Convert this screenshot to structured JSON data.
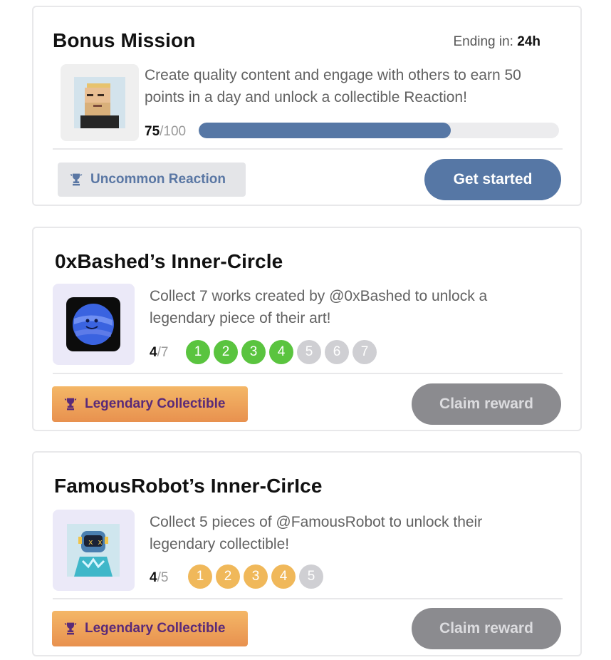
{
  "bonus": {
    "title": "Bonus Mission",
    "ending_label": "Ending in:",
    "ending_value": "24h",
    "description": "Create quality content and engage with others to earn 50 points in a day and unlock a collectible Reaction!",
    "progress_current": "75",
    "progress_total": "/100",
    "progress_fraction": 0.7,
    "reward_label": "Uncommon Reaction",
    "cta_label": "Get started"
  },
  "circle1": {
    "title": "0xBashed’s Inner-Circle",
    "description": "Collect 7 works created by @0xBashed to unlock a legendary piece of their art!",
    "progress_current": "4",
    "progress_total": "/7",
    "steps": [
      {
        "label": "1",
        "done": true
      },
      {
        "label": "2",
        "done": true
      },
      {
        "label": "3",
        "done": true
      },
      {
        "label": "4",
        "done": true
      },
      {
        "label": "5",
        "done": false
      },
      {
        "label": "6",
        "done": false
      },
      {
        "label": "7",
        "done": false
      }
    ],
    "reward_label": "Legendary Collectible",
    "cta_label": "Claim reward"
  },
  "circle2": {
    "title": "FamousRobot’s Inner-CirIce",
    "description": "Collect 5 pieces of @FamousRobot to unlock their legendary collectible!",
    "progress_current": "4",
    "progress_total": "/5",
    "steps": [
      {
        "label": "1",
        "done": true
      },
      {
        "label": "2",
        "done": true
      },
      {
        "label": "3",
        "done": true
      },
      {
        "label": "4",
        "done": true
      },
      {
        "label": "5",
        "done": false
      }
    ],
    "reward_label": "Legendary Collectible",
    "cta_label": "Claim reward"
  },
  "colors": {
    "accent_blue": "#5677a5",
    "green_done": "#5ac43f",
    "gold_done": "#f0b85a",
    "pending": "#cfcfd3",
    "disabled_button": "#8b8b8f"
  },
  "icons": {
    "reward": "trophy-icon",
    "bonus_avatar": "bearded-man-pixel-avatar",
    "circle1_avatar": "planet-face-icon",
    "circle2_avatar": "robot-avatar"
  }
}
